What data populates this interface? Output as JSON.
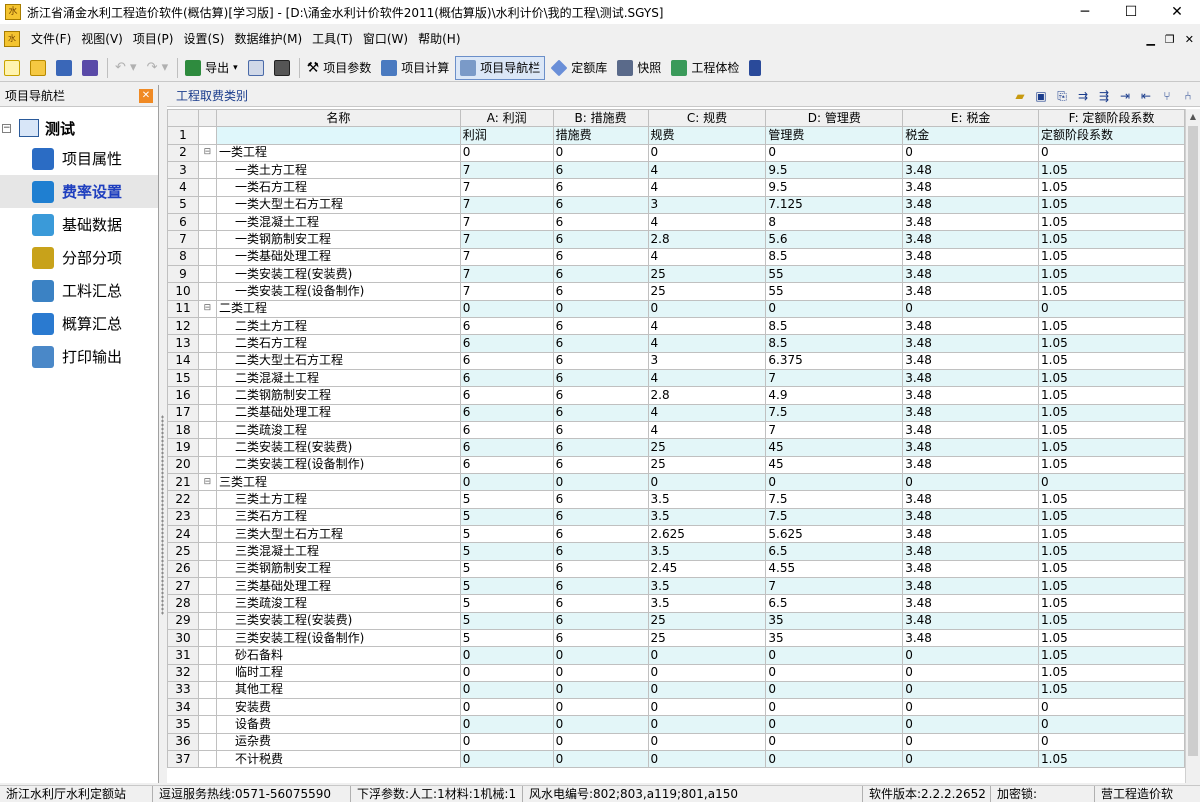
{
  "window": {
    "title": "浙江省涌金水利工程造价软件(概估算)[学习版] - [D:\\涌金水利计价软件2011(概估算版)\\水利计价\\我的工程\\测试.SGYS]",
    "app_icon_text": "水"
  },
  "menubar": {
    "icon_text": "水",
    "items": [
      "文件(F)",
      "视图(V)",
      "项目(P)",
      "设置(S)",
      "数据维护(M)",
      "工具(T)",
      "窗口(W)",
      "帮助(H)"
    ]
  },
  "toolbar": {
    "export_label": "导出",
    "project_params_label": "项目参数",
    "project_calc_label": "项目计算",
    "project_nav_label": "项目导航栏",
    "quota_lib_label": "定额库",
    "snapshot_label": "快照",
    "project_check_label": "工程体检"
  },
  "left_panel": {
    "header": "项目导航栏",
    "root": "测试",
    "items": [
      {
        "label": "项目属性",
        "icon": "project-properties-icon",
        "color": "#2b6cc4"
      },
      {
        "label": "费率设置",
        "icon": "rate-settings-icon",
        "color": "#1f7fd1",
        "selected": true
      },
      {
        "label": "基础数据",
        "icon": "base-data-icon",
        "color": "#3a9ad9"
      },
      {
        "label": "分部分项",
        "icon": "sub-items-icon",
        "color": "#c8a21a"
      },
      {
        "label": "工料汇总",
        "icon": "materials-summary-icon",
        "color": "#3b82c4"
      },
      {
        "label": "概算汇总",
        "icon": "estimate-summary-icon",
        "color": "#2a7ad0"
      },
      {
        "label": "打印输出",
        "icon": "print-icon",
        "color": "#4a88c8"
      }
    ]
  },
  "right_panel": {
    "header": "工程取费类别",
    "columns": [
      {
        "label": "名称"
      },
      {
        "label": "A: 利润"
      },
      {
        "label": "B: 措施费"
      },
      {
        "label": "C: 规费"
      },
      {
        "label": "D: 管理费"
      },
      {
        "label": "E: 税金"
      },
      {
        "label": "F: 定额阶段系数"
      }
    ],
    "rows": [
      {
        "n": "1",
        "tree": "",
        "name": "",
        "v": [
          "利润",
          "措施费",
          "规费",
          "管理费",
          "税金",
          "定额阶段系数"
        ]
      },
      {
        "n": "2",
        "tree": "⊟",
        "name": "一类工程",
        "v": [
          "0",
          "0",
          "0",
          "0",
          "0",
          "0"
        ]
      },
      {
        "n": "3",
        "tree": "",
        "name": "一类土方工程",
        "v": [
          "7",
          "6",
          "4",
          "9.5",
          "3.48",
          "1.05"
        ]
      },
      {
        "n": "4",
        "tree": "",
        "name": "一类石方工程",
        "v": [
          "7",
          "6",
          "4",
          "9.5",
          "3.48",
          "1.05"
        ]
      },
      {
        "n": "5",
        "tree": "",
        "name": "一类大型土石方工程",
        "v": [
          "7",
          "6",
          "3",
          "7.125",
          "3.48",
          "1.05"
        ]
      },
      {
        "n": "6",
        "tree": "",
        "name": "一类混凝土工程",
        "v": [
          "7",
          "6",
          "4",
          "8",
          "3.48",
          "1.05"
        ]
      },
      {
        "n": "7",
        "tree": "",
        "name": "一类钢筋制安工程",
        "v": [
          "7",
          "6",
          "2.8",
          "5.6",
          "3.48",
          "1.05"
        ]
      },
      {
        "n": "8",
        "tree": "",
        "name": "一类基础处理工程",
        "v": [
          "7",
          "6",
          "4",
          "8.5",
          "3.48",
          "1.05"
        ]
      },
      {
        "n": "9",
        "tree": "",
        "name": "一类安装工程(安装费)",
        "v": [
          "7",
          "6",
          "25",
          "55",
          "3.48",
          "1.05"
        ]
      },
      {
        "n": "10",
        "tree": "",
        "name": "一类安装工程(设备制作)",
        "v": [
          "7",
          "6",
          "25",
          "55",
          "3.48",
          "1.05"
        ]
      },
      {
        "n": "11",
        "tree": "⊟",
        "name": "二类工程",
        "v": [
          "0",
          "0",
          "0",
          "0",
          "0",
          "0"
        ]
      },
      {
        "n": "12",
        "tree": "",
        "name": "二类土方工程",
        "v": [
          "6",
          "6",
          "4",
          "8.5",
          "3.48",
          "1.05"
        ]
      },
      {
        "n": "13",
        "tree": "",
        "name": "二类石方工程",
        "v": [
          "6",
          "6",
          "4",
          "8.5",
          "3.48",
          "1.05"
        ]
      },
      {
        "n": "14",
        "tree": "",
        "name": "二类大型土石方工程",
        "v": [
          "6",
          "6",
          "3",
          "6.375",
          "3.48",
          "1.05"
        ]
      },
      {
        "n": "15",
        "tree": "",
        "name": "二类混凝土工程",
        "v": [
          "6",
          "6",
          "4",
          "7",
          "3.48",
          "1.05"
        ]
      },
      {
        "n": "16",
        "tree": "",
        "name": "二类钢筋制安工程",
        "v": [
          "6",
          "6",
          "2.8",
          "4.9",
          "3.48",
          "1.05"
        ]
      },
      {
        "n": "17",
        "tree": "",
        "name": "二类基础处理工程",
        "v": [
          "6",
          "6",
          "4",
          "7.5",
          "3.48",
          "1.05"
        ]
      },
      {
        "n": "18",
        "tree": "",
        "name": "二类疏浚工程",
        "v": [
          "6",
          "6",
          "4",
          "7",
          "3.48",
          "1.05"
        ]
      },
      {
        "n": "19",
        "tree": "",
        "name": "二类安装工程(安装费)",
        "v": [
          "6",
          "6",
          "25",
          "45",
          "3.48",
          "1.05"
        ]
      },
      {
        "n": "20",
        "tree": "",
        "name": "二类安装工程(设备制作)",
        "v": [
          "6",
          "6",
          "25",
          "45",
          "3.48",
          "1.05"
        ]
      },
      {
        "n": "21",
        "tree": "⊟",
        "name": "三类工程",
        "v": [
          "0",
          "0",
          "0",
          "0",
          "0",
          "0"
        ]
      },
      {
        "n": "22",
        "tree": "",
        "name": "三类土方工程",
        "v": [
          "5",
          "6",
          "3.5",
          "7.5",
          "3.48",
          "1.05"
        ]
      },
      {
        "n": "23",
        "tree": "",
        "name": "三类石方工程",
        "v": [
          "5",
          "6",
          "3.5",
          "7.5",
          "3.48",
          "1.05"
        ]
      },
      {
        "n": "24",
        "tree": "",
        "name": "三类大型土石方工程",
        "v": [
          "5",
          "6",
          "2.625",
          "5.625",
          "3.48",
          "1.05"
        ]
      },
      {
        "n": "25",
        "tree": "",
        "name": "三类混凝土工程",
        "v": [
          "5",
          "6",
          "3.5",
          "6.5",
          "3.48",
          "1.05"
        ]
      },
      {
        "n": "26",
        "tree": "",
        "name": "三类钢筋制安工程",
        "v": [
          "5",
          "6",
          "2.45",
          "4.55",
          "3.48",
          "1.05"
        ]
      },
      {
        "n": "27",
        "tree": "",
        "name": "三类基础处理工程",
        "v": [
          "5",
          "6",
          "3.5",
          "7",
          "3.48",
          "1.05"
        ]
      },
      {
        "n": "28",
        "tree": "",
        "name": "三类疏浚工程",
        "v": [
          "5",
          "6",
          "3.5",
          "6.5",
          "3.48",
          "1.05"
        ]
      },
      {
        "n": "29",
        "tree": "",
        "name": "三类安装工程(安装费)",
        "v": [
          "5",
          "6",
          "25",
          "35",
          "3.48",
          "1.05"
        ]
      },
      {
        "n": "30",
        "tree": "",
        "name": "三类安装工程(设备制作)",
        "v": [
          "5",
          "6",
          "25",
          "35",
          "3.48",
          "1.05"
        ]
      },
      {
        "n": "31",
        "tree": "",
        "name": "砂石备料",
        "v": [
          "0",
          "0",
          "0",
          "0",
          "0",
          "1.05"
        ]
      },
      {
        "n": "32",
        "tree": "",
        "name": "临时工程",
        "v": [
          "0",
          "0",
          "0",
          "0",
          "0",
          "1.05"
        ]
      },
      {
        "n": "33",
        "tree": "",
        "name": "其他工程",
        "v": [
          "0",
          "0",
          "0",
          "0",
          "0",
          "1.05"
        ]
      },
      {
        "n": "34",
        "tree": "",
        "name": "安装费",
        "v": [
          "0",
          "0",
          "0",
          "0",
          "0",
          "0"
        ]
      },
      {
        "n": "35",
        "tree": "",
        "name": "设备费",
        "v": [
          "0",
          "0",
          "0",
          "0",
          "0",
          "0"
        ]
      },
      {
        "n": "36",
        "tree": "",
        "name": "运杂费",
        "v": [
          "0",
          "0",
          "0",
          "0",
          "0",
          "0"
        ]
      },
      {
        "n": "37",
        "tree": "",
        "name": "不计税费",
        "v": [
          "0",
          "0",
          "0",
          "0",
          "0",
          "1.05"
        ]
      }
    ]
  },
  "statusbar": {
    "station": "浙江水利厅水利定额站",
    "hotline": "逗逗服务热线:0571-56075590",
    "params": "下浮参数:人工:1材料:1机械:1",
    "codes": "风水电编号:802;803,a119;801,a150",
    "version": "软件版本:2.2.2.2652",
    "lock": "加密锁:",
    "product": "营工程造价软"
  }
}
